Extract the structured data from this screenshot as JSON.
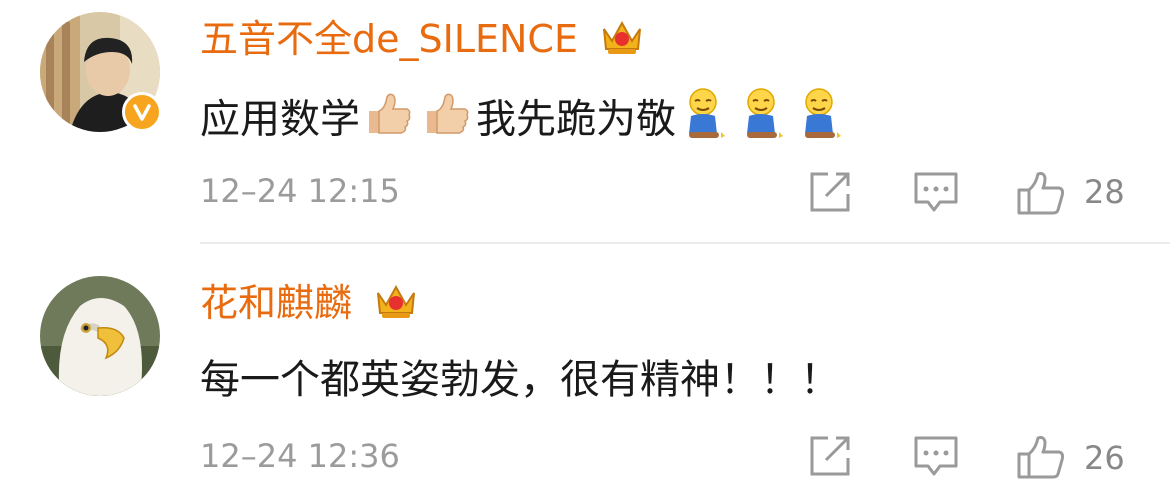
{
  "comments": [
    {
      "username": "五音不全de_SILENCE",
      "avatar_icon": "user-avatar-photo",
      "verified_badge_icon": "verified-v-badge-icon",
      "vip_icon": "crown-vip-icon",
      "content_prefix": "应用数学",
      "content_mid": "我先跪为敬",
      "emojis": [
        "thumbs-up-icon",
        "thumbs-up-icon",
        "kneeling-emoji-icon",
        "kneeling-emoji-icon",
        "kneeling-emoji-icon"
      ],
      "timestamp": "12–24 12:15",
      "like_count": "28"
    },
    {
      "username": "花和麒麟",
      "avatar_icon": "eagle-avatar-photo",
      "vip_icon": "crown-vip-icon",
      "content": "每一个都英姿勃发，很有精神！！！",
      "timestamp": "12–24 12:36",
      "like_count": "26"
    }
  ],
  "colors": {
    "username": "#e86b0f",
    "text": "#1a1a1a",
    "meta": "#9b9b9b",
    "badge": "#f7a51e",
    "divider": "#ececec"
  }
}
